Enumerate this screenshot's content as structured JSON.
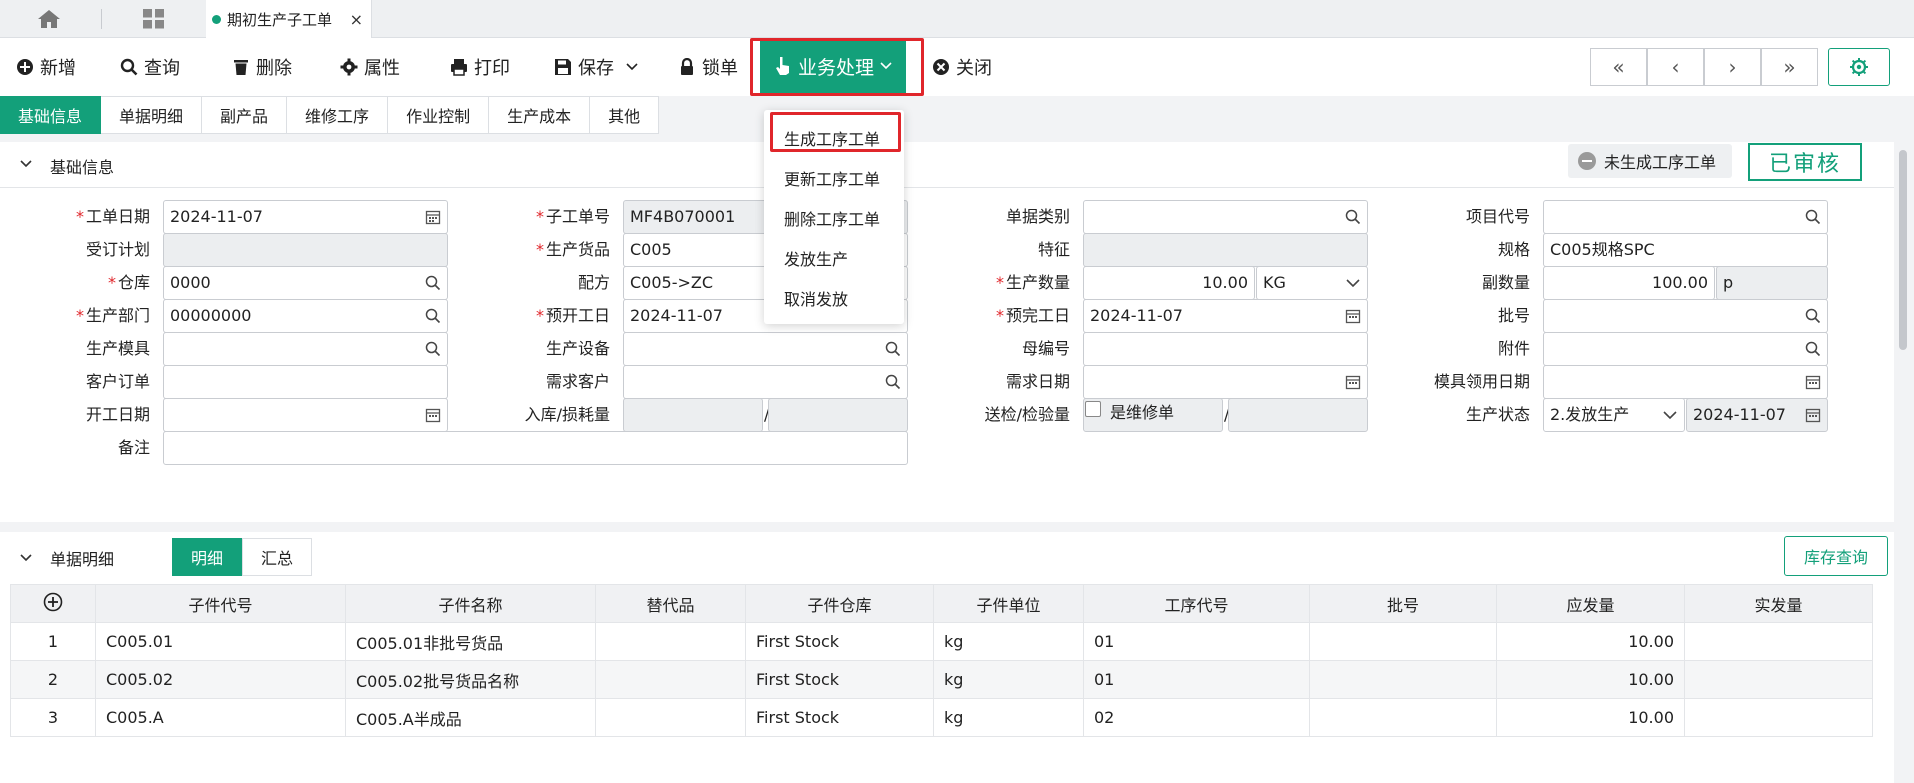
{
  "tabs": {
    "active_tab_label": "期初生产子工单",
    "close_glyph": "×"
  },
  "toolbar": {
    "new": "新增",
    "query": "查询",
    "delete": "删除",
    "attributes": "属性",
    "print": "打印",
    "save": "保存",
    "lock": "锁单",
    "business": "业务处理",
    "close": "关闭",
    "pager": [
      "«",
      "‹",
      "›",
      "»"
    ]
  },
  "subtabs": [
    "基础信息",
    "单据明细",
    "副产品",
    "维修工序",
    "作业控制",
    "生产成本",
    "其他"
  ],
  "dropdown": {
    "items": [
      "生成工序工单",
      "更新工序工单",
      "删除工序工单",
      "发放生产",
      "取消发放"
    ]
  },
  "basic": {
    "section_title": "基础信息",
    "status_text": "未生成工序工单",
    "approved_text": "已审核",
    "labels": {
      "work_date": "工单日期",
      "order_plan": "受订计划",
      "warehouse": "仓库",
      "dept": "生产部门",
      "mold": "生产模具",
      "customer_order": "客户订单",
      "start_date": "开工日期",
      "remark": "备注",
      "sub_order_no": "子工单号",
      "product": "生产货品",
      "formula": "配方",
      "plan_start": "预开工日",
      "equipment": "生产设备",
      "demand_customer": "需求客户",
      "in_loss": "入库/损耗量",
      "doc_type": "单据类别",
      "feature": "特征",
      "prod_qty": "生产数量",
      "plan_finish": "预完工日",
      "parent_no": "母编号",
      "demand_date": "需求日期",
      "inspect_qty": "送检/检验量",
      "is_repair": "是维修单",
      "project_code": "项目代号",
      "spec": "规格",
      "sub_qty": "副数量",
      "batch": "批号",
      "attachment": "附件",
      "mold_date": "模具领用日期",
      "prod_status": "生产状态"
    },
    "values": {
      "work_date": "2024-11-07",
      "warehouse": "0000",
      "dept": "00000000",
      "sub_order_no": "MF4B070001",
      "product": "C005",
      "formula": "C005->ZC",
      "plan_start": "2024-11-07",
      "prod_qty": "10.00",
      "prod_unit": "KG",
      "plan_finish": "2024-11-07",
      "spec": "C005规格SPC",
      "sub_qty": "100.00",
      "sub_unit": "p",
      "prod_status": "2.发放生产",
      "status_date": "2024-11-07",
      "slash": "/"
    }
  },
  "detail": {
    "section_title": "单据明细",
    "seg": [
      "明细",
      "汇总"
    ],
    "stock_query": "库存查询",
    "columns": [
      "子件代号",
      "子件名称",
      "替代品",
      "子件仓库",
      "子件单位",
      "工序代号",
      "批号",
      "应发量",
      "实发量"
    ],
    "rows": [
      {
        "no": "1",
        "code": "C005.01",
        "name": "C005.01非批号货品",
        "sub": "",
        "wh": "First Stock",
        "unit": "kg",
        "op": "01",
        "batch": "",
        "qty": "10.00",
        "actual": ""
      },
      {
        "no": "2",
        "code": "C005.02",
        "name": "C005.02批号货品名称",
        "sub": "",
        "wh": "First Stock",
        "unit": "kg",
        "op": "01",
        "batch": "",
        "qty": "10.00",
        "actual": ""
      },
      {
        "no": "3",
        "code": "C005.A",
        "name": "C005.A半成品",
        "sub": "",
        "wh": "First Stock",
        "unit": "kg",
        "op": "02",
        "batch": "",
        "qty": "10.00",
        "actual": ""
      }
    ]
  },
  "colors": {
    "accent": "#13a07a",
    "highlight": "#e0262b"
  }
}
